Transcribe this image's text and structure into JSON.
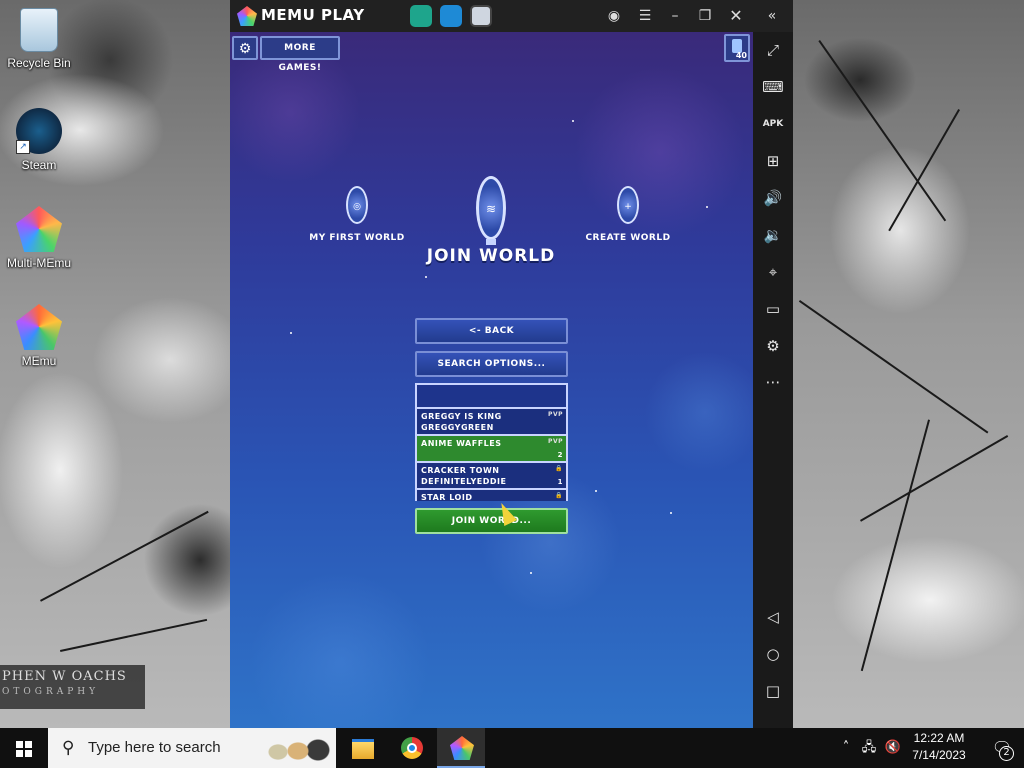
{
  "desktop": {
    "icons": [
      {
        "label": "Recycle Bin"
      },
      {
        "label": "Steam"
      },
      {
        "label": "Multi-MEmu"
      },
      {
        "label": "MEmu"
      }
    ],
    "watermark": {
      "line1": "PHEN W OACHS",
      "line2": "OTOGRAPHY"
    }
  },
  "emulator": {
    "title": "MEMU PLAY",
    "controls": {
      "account": "account-icon",
      "menu": "menu-icon",
      "minimize": "minimize-icon",
      "restore": "restore-icon",
      "close": "close-icon",
      "collapse": "collapse-sidebar-icon"
    },
    "sidebar_icons": [
      "fullscreen",
      "keyboard",
      "apk",
      "add-window",
      "volume-up",
      "volume-down",
      "location",
      "folder",
      "settings",
      "more",
      "back",
      "home",
      "recents"
    ]
  },
  "game": {
    "more_games_label": "MORE GAMES!",
    "pets_count": "40",
    "portals": {
      "left_label": "MY FIRST WORLD",
      "center_label": "JOIN WORLD",
      "right_label": "CREATE WORLD"
    },
    "back_label": "<- BACK",
    "search_options_label": "SEARCH OPTIONS...",
    "search_value": "",
    "worlds": [
      {
        "name": "GREGGY IS KING",
        "owner": "GREGGYGREEN",
        "badge": "PVP",
        "players": ""
      },
      {
        "name": "ANIME WAFFLES",
        "owner": "",
        "badge": "PVP",
        "players": "2"
      },
      {
        "name": "CRACKER TOWN",
        "owner": "DEFINITELYEDDIE",
        "badge": "🔒",
        "players": "1"
      },
      {
        "name": "STAR LOID",
        "owner": "",
        "badge": "🔒",
        "players": ""
      }
    ],
    "join_button_label": "JOIN WORLD..."
  },
  "taskbar": {
    "search_placeholder": "Type here to search",
    "time": "12:22 AM",
    "date": "7/14/2023",
    "notification_count": "2"
  }
}
